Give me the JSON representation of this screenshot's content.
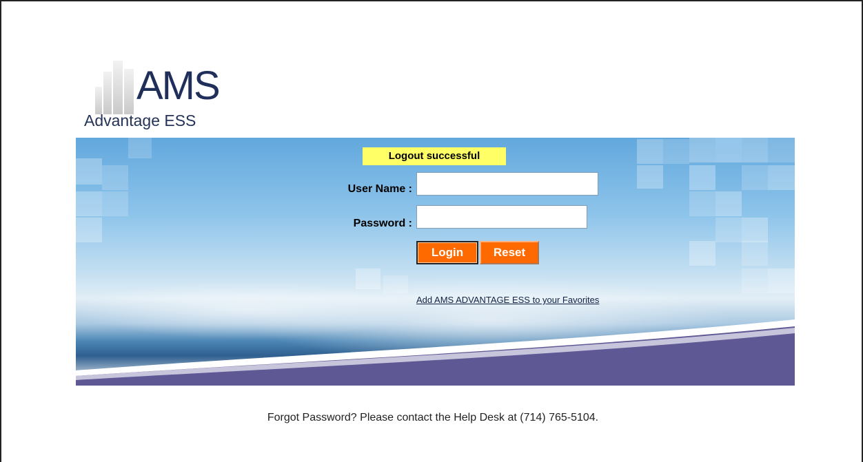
{
  "logo": {
    "title": "AMS",
    "subtitle": "Advantage ESS"
  },
  "login": {
    "status_message": "Logout successful",
    "username_label": "User Name :",
    "username_value": "",
    "password_label": "Password :",
    "password_value": "",
    "login_label": "Login",
    "reset_label": "Reset",
    "favorites_link": "Add AMS ADVANTAGE ESS to your Favorites"
  },
  "footer": {
    "help_text": "Forgot Password? Please contact the Help Desk at (714) 765-5104."
  },
  "colors": {
    "accent": "#ff6a00",
    "message_bg": "#ffff66",
    "brand_navy": "#1f2f5a",
    "swoosh": "#5e5894"
  }
}
